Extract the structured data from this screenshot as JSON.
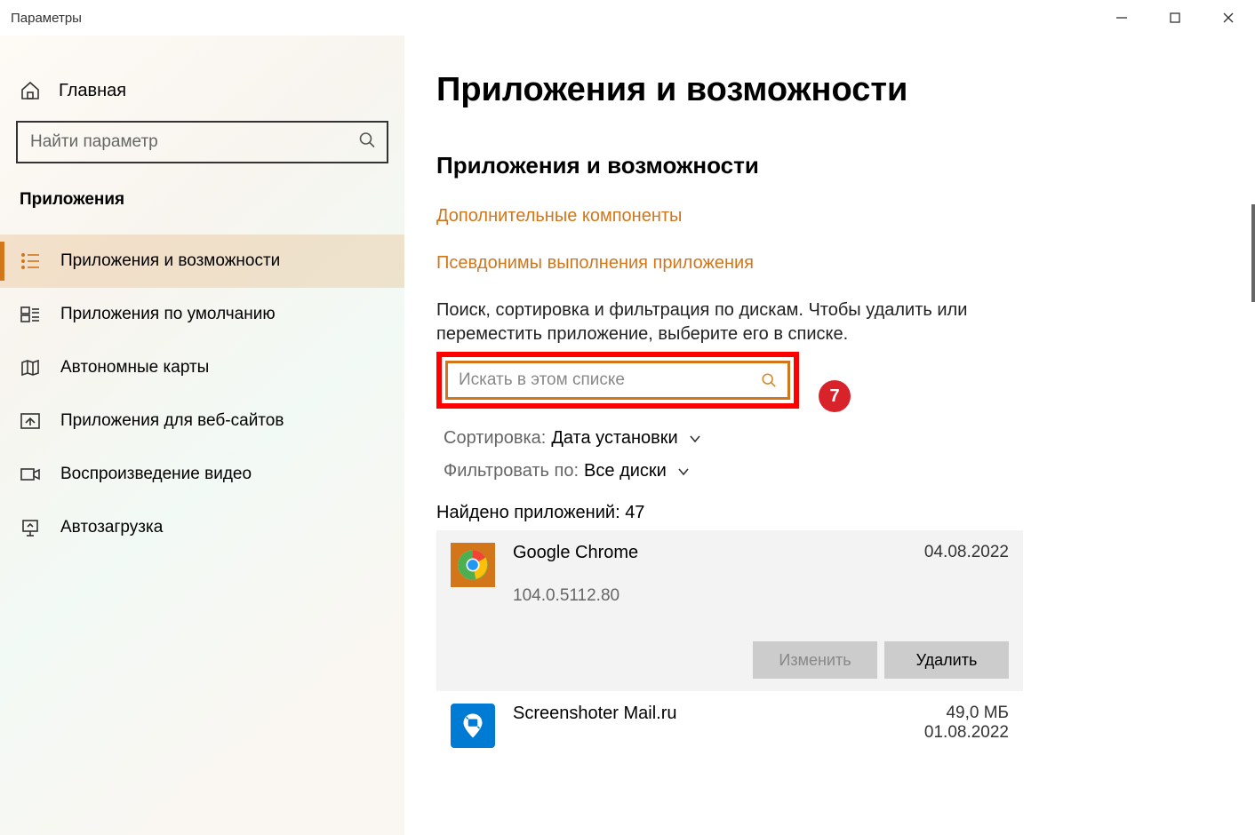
{
  "window": {
    "title": "Параметры"
  },
  "sidebar": {
    "home": "Главная",
    "search_placeholder": "Найти параметр",
    "category": "Приложения",
    "items": [
      {
        "label": "Приложения и возможности",
        "active": true
      },
      {
        "label": "Приложения по умолчанию"
      },
      {
        "label": "Автономные карты"
      },
      {
        "label": "Приложения для веб-сайтов"
      },
      {
        "label": "Воспроизведение видео"
      },
      {
        "label": "Автозагрузка"
      }
    ]
  },
  "content": {
    "page_title": "Приложения и возможности",
    "section_title": "Приложения и возможности",
    "links": {
      "optional": "Дополнительные компоненты",
      "aliases": "Псевдонимы выполнения приложения"
    },
    "hint1": "Поиск, сортировка и фильтрация по дискам. Чтобы удалить или",
    "hint2": "переместить приложение, выберите его в списке.",
    "list_search_placeholder": "Искать в этом списке",
    "sort": {
      "label": "Сортировка:",
      "value": "Дата установки"
    },
    "filter": {
      "label": "Фильтровать по:",
      "value": "Все диски"
    },
    "found_label": "Найдено приложений:",
    "found_count": "47",
    "apps": [
      {
        "name": "Google Chrome",
        "version": "104.0.5112.80",
        "date": "04.08.2022",
        "size": ""
      },
      {
        "name": "Screenshoter Mail.ru",
        "version": "",
        "date": "01.08.2022",
        "size": "49,0 МБ"
      }
    ],
    "buttons": {
      "modify": "Изменить",
      "uninstall": "Удалить"
    },
    "annotation_number": "7"
  }
}
